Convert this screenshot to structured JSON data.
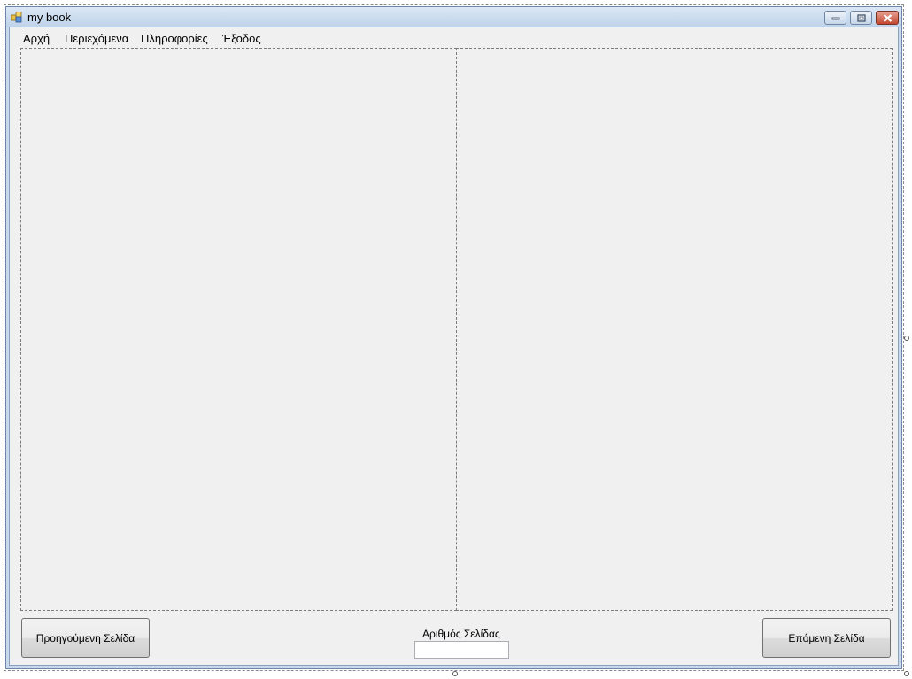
{
  "window": {
    "title": "my book"
  },
  "menu": {
    "items": [
      {
        "label": "Αρχή"
      },
      {
        "label": "Περιεχόμενα"
      },
      {
        "label": "Πληροφορίες"
      },
      {
        "label": "Έξοδος"
      }
    ]
  },
  "footer": {
    "prev_label": "Προηγούμενη Σελίδα",
    "next_label": "Επόμενη Σελίδα",
    "page_number_label": "Αριθμός Σελίδας",
    "page_number_value": ""
  },
  "colors": {
    "titlebar_top": "#dbe7f5",
    "titlebar_bottom": "#bfd3ea",
    "client_background": "#f0f0f0",
    "close_button": "#c2462f"
  },
  "icons": {
    "app": "app-icon",
    "minimize": "minimize-icon",
    "maximize": "maximize-icon",
    "close": "close-icon"
  }
}
